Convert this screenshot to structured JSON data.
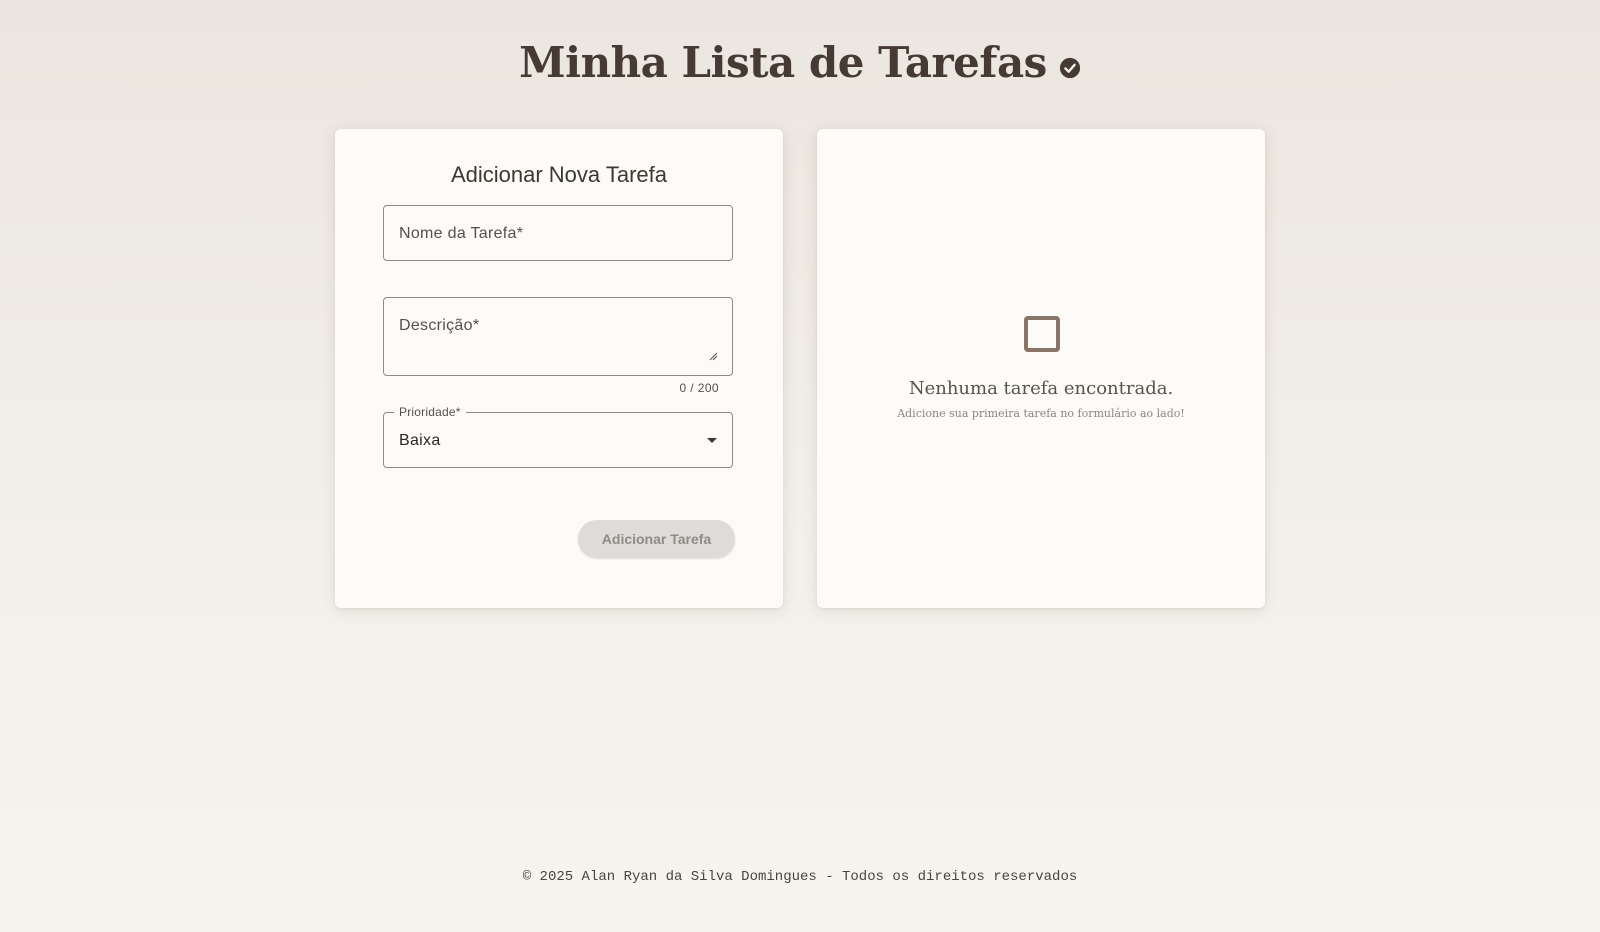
{
  "header": {
    "title": "Minha Lista de Tarefas",
    "icon": "check-circle-icon"
  },
  "form": {
    "title": "Adicionar Nova Tarefa",
    "name_field": {
      "placeholder": "Nome da Tarefa*",
      "value": ""
    },
    "description_field": {
      "placeholder": "Descrição*",
      "value": "",
      "counter": "0 / 200"
    },
    "priority_field": {
      "label": "Prioridade*",
      "value": "Baixa"
    },
    "submit_label": "Adicionar Tarefa"
  },
  "list": {
    "empty_icon": "empty-checkbox-icon",
    "empty_title": "Nenhuma tarefa encontrada.",
    "empty_subtitle": "Adicione sua primeira tarefa no formulário ao lado!"
  },
  "footer": {
    "text": "© 2025 Alan Ryan da Silva Domingues - Todos os direitos reservados"
  },
  "colors": {
    "accent_brown": "#887468",
    "title_text": "#453b34",
    "card_bg": "#fcfbf7",
    "disabled_button": "#dedcd8"
  }
}
